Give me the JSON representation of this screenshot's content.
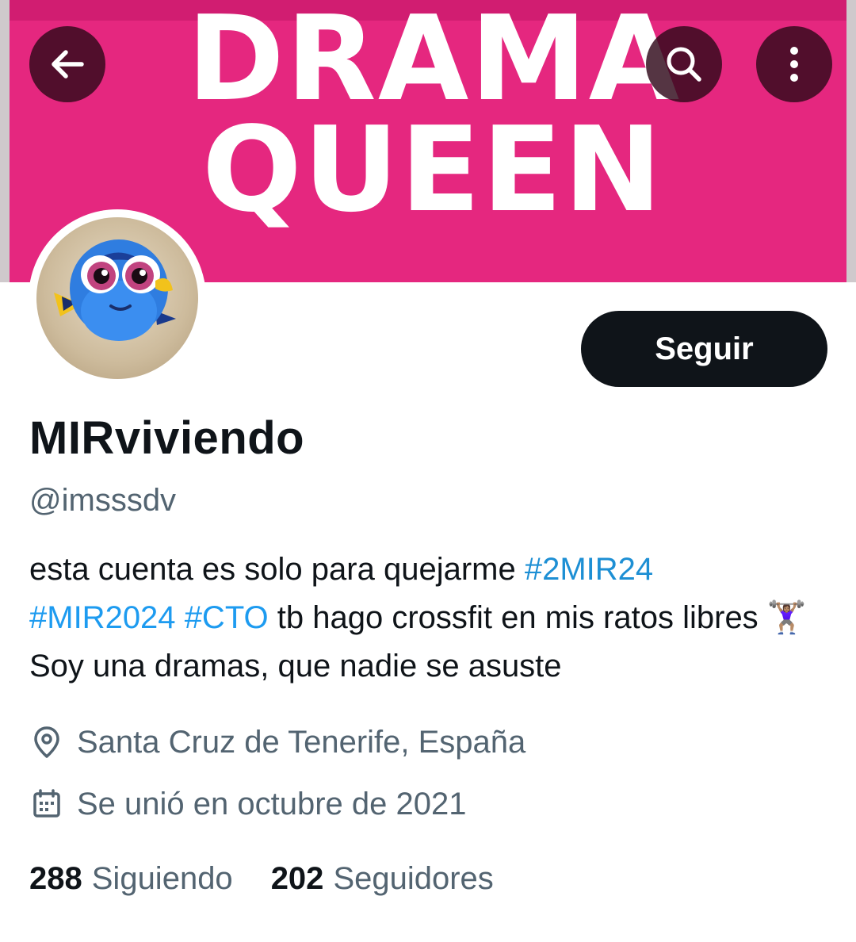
{
  "header": {
    "back_icon": "arrow-left-icon",
    "search_icon": "search-icon",
    "more_icon": "more-vertical-icon"
  },
  "banner": {
    "line1": "DRAMA",
    "line2": "QUEEN",
    "background_color": "#e5277f"
  },
  "avatar": {
    "description_icon": "avatar-fish"
  },
  "follow_button": {
    "label": "Seguir"
  },
  "profile": {
    "display_name": "MIRviviendo",
    "handle": "@imsssdv",
    "bio": {
      "part1": "esta cuenta es solo para quejarme ",
      "tag1": "#2MIR24",
      "tag2": "#MIR2024",
      "tag3": "#CTO",
      "part2": " tb hago crossfit en mis ratos libres ",
      "emoji": "🏋🏽‍♀️",
      "part3": " Soy una dramas, que nadie se asuste"
    },
    "location": "Santa Cruz de Tenerife, España",
    "joined": "Se unió en octubre de 2021"
  },
  "stats": {
    "following_count": "288",
    "following_label": "Siguiendo",
    "followers_count": "202",
    "followers_label": "Seguidores"
  },
  "colors": {
    "text_primary": "#0f1419",
    "text_secondary": "#536471",
    "link": "#1d9bf0",
    "button_bg": "#0f1419"
  }
}
